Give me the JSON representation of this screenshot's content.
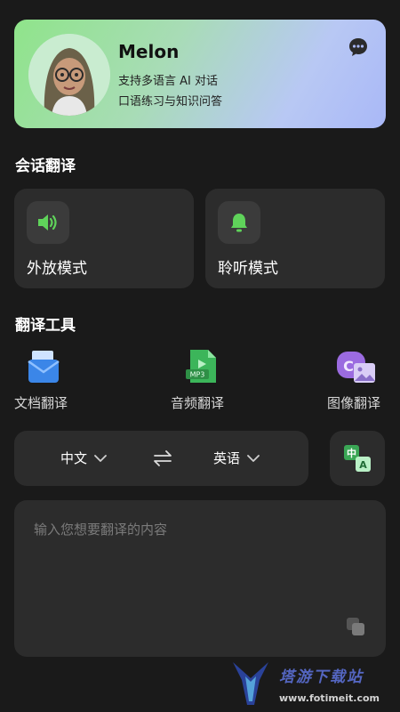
{
  "profile": {
    "name": "Melon",
    "line1": "支持多语言 AI 对话",
    "line2": "口语练习与知识问答"
  },
  "sections": {
    "conversation": "会话翻译",
    "tools": "翻译工具"
  },
  "modes": [
    {
      "label": "外放模式",
      "icon": "speaker-icon"
    },
    {
      "label": "聆听模式",
      "icon": "bell-icon"
    }
  ],
  "tools": [
    {
      "label": "文档翻译",
      "icon": "document-envelope-icon"
    },
    {
      "label": "音频翻译",
      "icon": "mp3-file-icon",
      "badge": "MP3"
    },
    {
      "label": "图像翻译",
      "icon": "image-translate-icon"
    }
  ],
  "language": {
    "source": "中文",
    "target": "英语",
    "translate_icon_text_zh": "中",
    "translate_icon_text_en": "A"
  },
  "input": {
    "placeholder": "输入您想要翻译的内容"
  },
  "watermark": {
    "text": "塔游下载站",
    "url": "www.fotimeit.com"
  },
  "colors": {
    "background": "#1a1a1a",
    "card": "#2c2c2c",
    "accent_green": "#5fd35a"
  }
}
